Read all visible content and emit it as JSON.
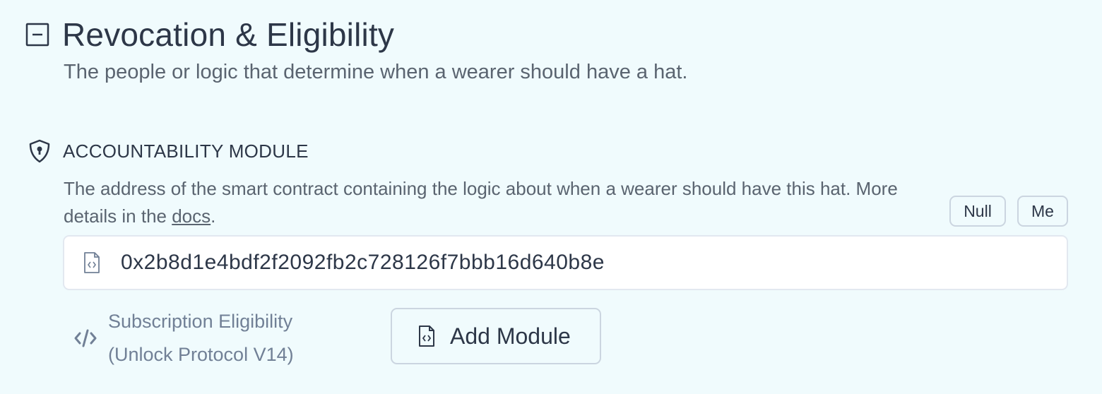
{
  "section": {
    "title": "Revocation & Eligibility",
    "description": "The people or logic that determine when a wearer should have a hat.",
    "collapse_icon": "minus-square-icon"
  },
  "module": {
    "label": "ACCOUNTABILITY MODULE",
    "label_icon": "shield-icon",
    "description_before_link": "The address of the smart contract containing the logic about when a wearer should have this hat. More details in the ",
    "docs_link": "docs",
    "description_after_link": ".",
    "chips": {
      "null_label": "Null",
      "me_label": "Me"
    },
    "address_value": "0x2b8d1e4bdf2f2092fb2c728126f7bbb16d640b8e",
    "address_icon": "file-code-icon",
    "detected_module": {
      "icon": "code-icon",
      "name_line1": "Subscription Eligibility",
      "name_line2": "(Unlock Protocol V14)"
    },
    "add_module_label": "Add Module"
  },
  "colors": {
    "background": "#f0fbfd",
    "text_primary": "#2d3748",
    "text_secondary": "#5a6470",
    "text_muted": "#718096",
    "border": "#cbd5e0"
  }
}
